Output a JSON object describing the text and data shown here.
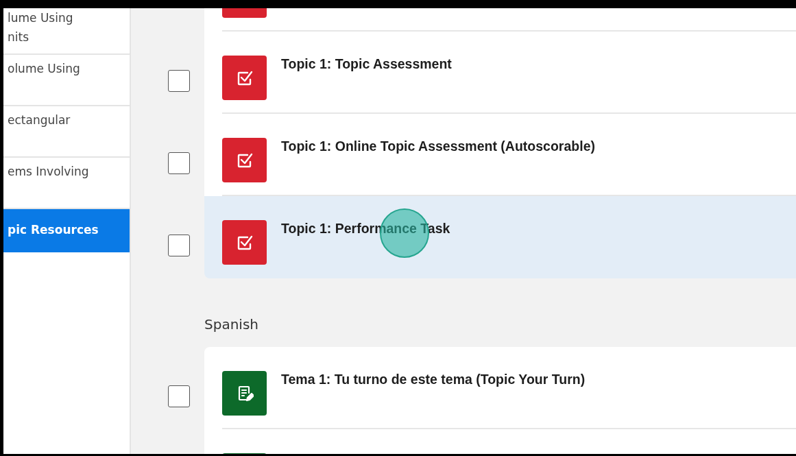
{
  "sidebar": {
    "items": [
      {
        "lines": [
          "lume Using",
          "nits"
        ],
        "selected": false
      },
      {
        "lines": [
          "olume Using"
        ],
        "selected": false
      },
      {
        "lines": [
          "ectangular"
        ],
        "selected": false
      },
      {
        "lines": [
          "ems Involving"
        ],
        "selected": false
      },
      {
        "lines": [
          "pic Resources"
        ],
        "selected": true
      }
    ]
  },
  "sections": [
    {
      "rows": [
        {
          "kind": "assessment",
          "selected": false
        },
        {
          "kind": "assessment",
          "title": "Topic 1: Topic Assessment",
          "checked": false,
          "selected": false
        },
        {
          "kind": "assessment",
          "title": "Topic 1: Online Topic Assessment (Autoscorable)",
          "checked": false,
          "selected": false
        },
        {
          "kind": "assessment",
          "title": "Topic 1: Performance Task",
          "checked": false,
          "selected": true,
          "click_ring": true
        }
      ]
    },
    {
      "heading": "Spanish",
      "rows": [
        {
          "kind": "practice",
          "title": "Tema 1: Tu turno de este tema (Topic Your Turn)",
          "checked": false,
          "selected": false
        },
        {
          "kind": "practice",
          "selected": false
        }
      ]
    }
  ]
}
